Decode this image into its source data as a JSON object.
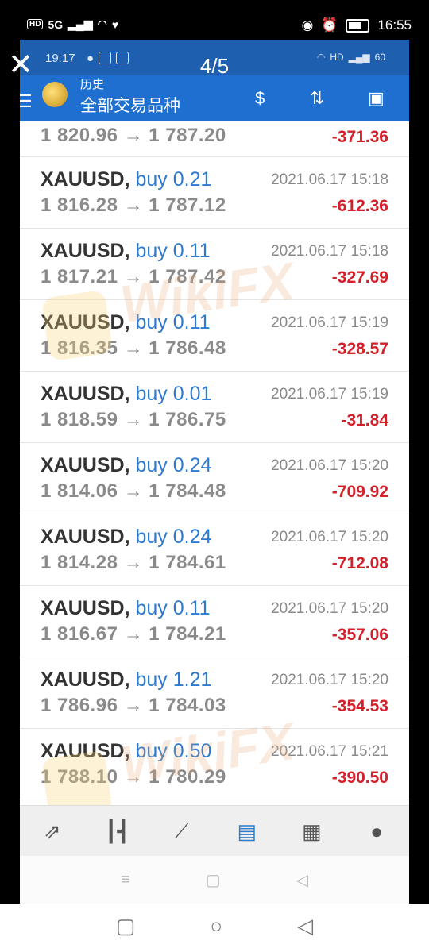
{
  "outer_status": {
    "time": "16:55",
    "network": "5G"
  },
  "viewer": {
    "page_indicator": "4/5"
  },
  "inner_status": {
    "time": "19:17",
    "network": "HD",
    "battery": "60"
  },
  "header": {
    "small_title": "历史",
    "title": "全部交易品种"
  },
  "first_row": {
    "prices": "1 820.96 → 1 787.20",
    "profit": "-371.36"
  },
  "trades": [
    {
      "symbol": "XAUUSD,",
      "side": "buy 0.21",
      "date": "2021.06.17 15:18",
      "prices": "1 816.28 → 1 787.12",
      "profit": "-612.36"
    },
    {
      "symbol": "XAUUSD,",
      "side": "buy 0.11",
      "date": "2021.06.17 15:18",
      "prices": "1 817.21 → 1 787.42",
      "profit": "-327.69"
    },
    {
      "symbol": "XAUUSD,",
      "side": "buy 0.11",
      "date": "2021.06.17 15:19",
      "prices": "1 816.35 → 1 786.48",
      "profit": "-328.57"
    },
    {
      "symbol": "XAUUSD,",
      "side": "buy 0.01",
      "date": "2021.06.17 15:19",
      "prices": "1 818.59 → 1 786.75",
      "profit": "-31.84"
    },
    {
      "symbol": "XAUUSD,",
      "side": "buy 0.24",
      "date": "2021.06.17 15:20",
      "prices": "1 814.06 → 1 784.48",
      "profit": "-709.92"
    },
    {
      "symbol": "XAUUSD,",
      "side": "buy 0.24",
      "date": "2021.06.17 15:20",
      "prices": "1 814.28 → 1 784.61",
      "profit": "-712.08"
    },
    {
      "symbol": "XAUUSD,",
      "side": "buy 0.11",
      "date": "2021.06.17 15:20",
      "prices": "1 816.67 → 1 784.21",
      "profit": "-357.06"
    },
    {
      "symbol": "XAUUSD,",
      "side": "buy 1.21",
      "date": "2021.06.17 15:20",
      "prices": "1 786.96 → 1 784.03",
      "profit": "-354.53"
    },
    {
      "symbol": "XAUUSD,",
      "side": "buy 0.50",
      "date": "2021.06.17 15:21",
      "prices": "1 788.10 → 1 780.29",
      "profit": "-390.50"
    }
  ],
  "watermark": "WikiFX",
  "colors": {
    "header_blue": "#1e6fd0",
    "loss_red": "#d3202a",
    "buy_blue": "#2d7ad0"
  },
  "bottom_nav": [
    "quotes-icon",
    "chart-icon",
    "trade-icon",
    "history-icon",
    "news-icon",
    "chat-icon"
  ]
}
